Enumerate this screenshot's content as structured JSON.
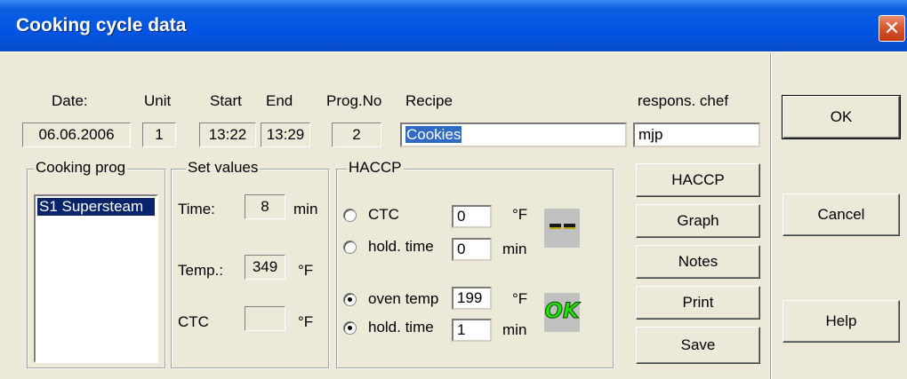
{
  "window": {
    "title": "Cooking cycle data",
    "close_symbol": "✕"
  },
  "header": {
    "date_label": "Date:",
    "date": "06.06.2006",
    "unit_label": "Unit",
    "unit": "1",
    "start_label": "Start",
    "start": "13:22",
    "end_label": "End",
    "end": "13:29",
    "prog_label": "Prog.No",
    "prog": "2",
    "recipe_label": "Recipe",
    "recipe": "Cookies",
    "chef_label": "respons. chef",
    "chef": "mjp"
  },
  "cooking_prog": {
    "title": "Cooking prog",
    "items": [
      "S1 Supersteam"
    ]
  },
  "set_values": {
    "title": "Set values",
    "time_label": "Time:",
    "time": "8",
    "time_unit": "min",
    "temp_label": "Temp.:",
    "temp": "349",
    "temp_unit": "°F",
    "ctc_label": "CTC",
    "ctc": "",
    "ctc_unit": "°F"
  },
  "haccp": {
    "title": "HACCP",
    "ctc_label": "CTC",
    "ctc_value": "0",
    "ctc_unit": "°F",
    "ctc_selected": false,
    "hold1_label": "hold. time",
    "hold1_value": "0",
    "hold1_unit": "min",
    "hold1_selected": false,
    "oven_label": "oven temp",
    "oven_value": "199",
    "oven_unit": "°F",
    "oven_selected": true,
    "hold2_label": "hold. time",
    "hold2_value": "1",
    "hold2_unit": "min",
    "hold2_selected": true,
    "status_ok": "OK"
  },
  "buttons": {
    "haccp": "HACCP",
    "graph": "Graph",
    "notes": "Notes",
    "print": "Print",
    "save": "Save",
    "ok": "OK",
    "cancel": "Cancel",
    "help": "Help"
  }
}
